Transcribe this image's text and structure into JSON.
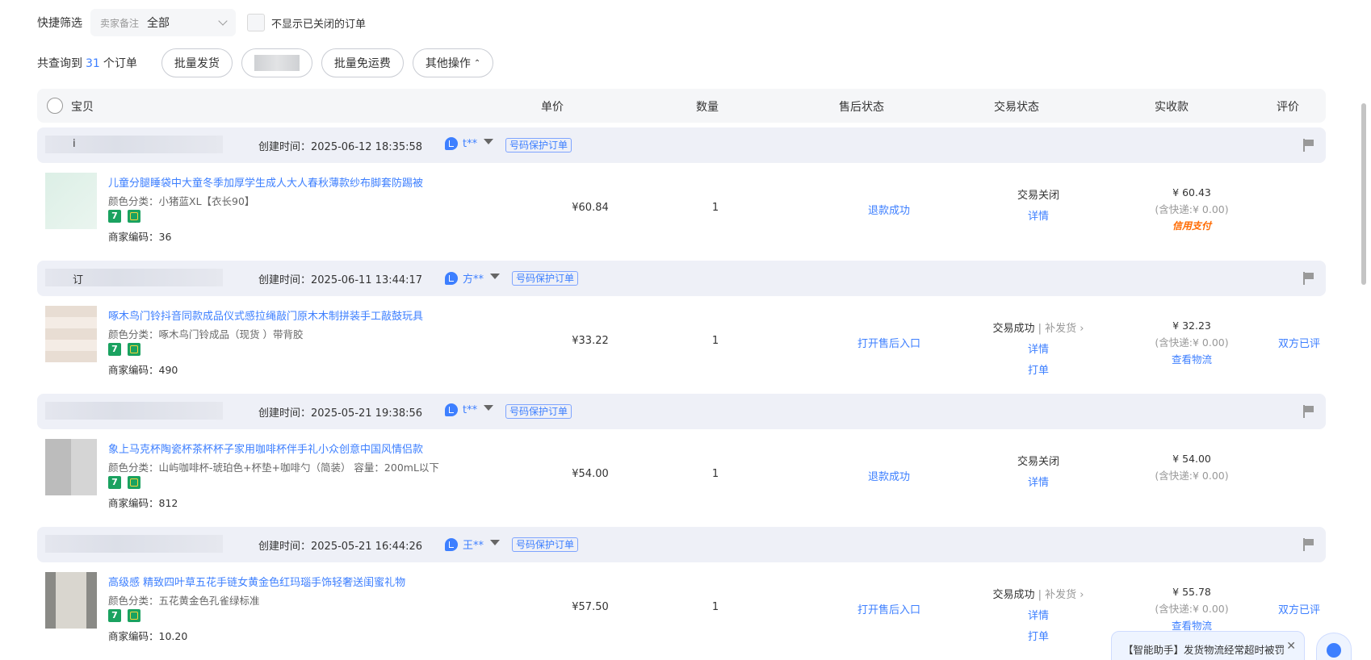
{
  "filter": {
    "label": "快捷筛选",
    "select_prefix": "卖家备注",
    "select_value": "全部",
    "hide_closed_label": "不显示已关闭的订单"
  },
  "actions": {
    "count_prefix": "共查询到",
    "count": "31",
    "count_suffix": "个订单",
    "batch_ship": "批量发货",
    "batch_free_shipping": "批量免运费",
    "other_ops": "其他操作"
  },
  "columns": {
    "item": "宝贝",
    "unit_price": "单价",
    "quantity": "数量",
    "after_sale": "售后状态",
    "trade_status": "交易状态",
    "paid": "实收款",
    "review": "评价"
  },
  "orders": [
    {
      "order_no_prefix": "i",
      "created": "创建时间：2025-06-12 18:35:58",
      "buyer": "t**",
      "protect": "号码保护订单",
      "title": "儿童分腿睡袋中大童冬季加厚学生成人大人春秋薄款纱布脚套防踢被",
      "sku": "颜色分类：小猪蓝XL【衣长90】",
      "merchant": "商家编码：36",
      "price": "¥60.84",
      "qty": "1",
      "after_sale": "退款成功",
      "trade_status": "交易关闭",
      "trade_sub": "",
      "detail": "详情",
      "print": "",
      "paid_amount": "¥ 60.43",
      "paid_ship": "(含快递:¥ 0.00)",
      "paid_extra": "信用支付",
      "paid_link": "",
      "review": ""
    },
    {
      "order_no_prefix": "订",
      "created": "创建时间：2025-06-11 13:44:17",
      "buyer": "方**",
      "protect": "号码保护订单",
      "title": "啄木鸟门铃抖音同款成品仪式感拉绳敲门原木木制拼装手工敲鼓玩具",
      "sku": "颜色分类：啄木鸟门铃成品（现货 ）带背胶",
      "merchant": "商家编码：490",
      "price": "¥33.22",
      "qty": "1",
      "after_sale": "打开售后入口",
      "trade_status": "交易成功",
      "trade_sub": "| 补发货 ›",
      "detail": "详情",
      "print": "打单",
      "paid_amount": "¥ 32.23",
      "paid_ship": "(含快递:¥ 0.00)",
      "paid_extra": "",
      "paid_link": "查看物流",
      "review": "双方已评"
    },
    {
      "order_no_prefix": "",
      "created": "创建时间：2025-05-21 19:38:56",
      "buyer": "t**",
      "protect": "号码保护订单",
      "title": "象上马克杯陶瓷杯茶杯杯子家用咖啡杯伴手礼小众创意中国风情侣款",
      "sku": "颜色分类：山屿咖啡杯-琥珀色+杯垫+咖啡勺（简装）  容量：200mL以下",
      "merchant": "商家编码：812",
      "price": "¥54.00",
      "qty": "1",
      "after_sale": "退款成功",
      "trade_status": "交易关闭",
      "trade_sub": "",
      "detail": "详情",
      "print": "",
      "paid_amount": "¥ 54.00",
      "paid_ship": "(含快递:¥ 0.00)",
      "paid_extra": "",
      "paid_link": "",
      "review": ""
    },
    {
      "order_no_prefix": "",
      "created": "创建时间：2025-05-21 16:44:26",
      "buyer": "王**",
      "protect": "号码保护订单",
      "title": "高级感 精致四叶草五花手链女黄金色红玛瑙手饰轻奢送闺蜜礼物",
      "sku": "颜色分类：五花黄金色孔雀绿标准",
      "merchant": "商家编码：10.20",
      "price": "¥57.50",
      "qty": "1",
      "after_sale": "打开售后入口",
      "trade_status": "交易成功",
      "trade_sub": "| 补发货 ›",
      "detail": "详情",
      "print": "打单",
      "paid_amount": "¥ 55.78",
      "paid_ship": "(含快递:¥ 0.00)",
      "paid_extra": "",
      "paid_link": "查看物流",
      "review": "双方已评"
    }
  ],
  "assistant": {
    "text": "【智能助手】发货物流经常超时被罚",
    "close": "✕"
  },
  "badge7": "7"
}
